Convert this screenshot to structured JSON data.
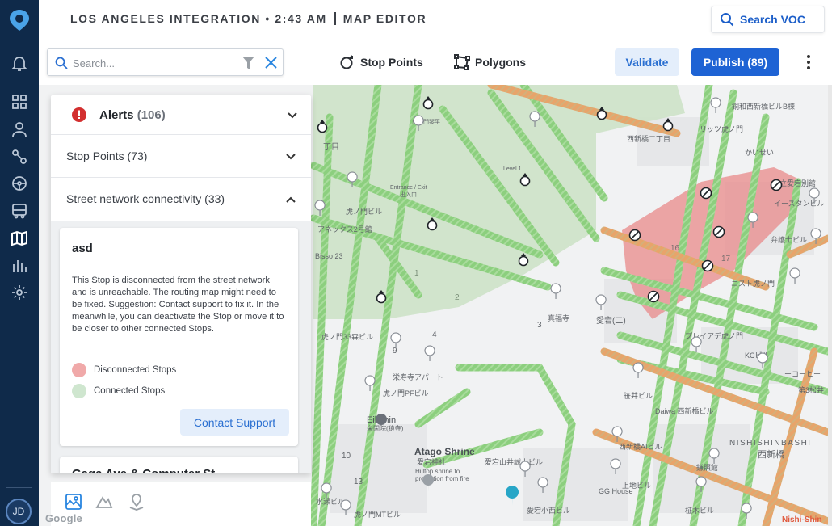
{
  "header": {
    "title": "LOS ANGELES INTEGRATION • 2:43 AM",
    "section": "MAP EDITOR",
    "search_voc_label": "Search VOC"
  },
  "toolbar": {
    "search_placeholder": "Search...",
    "stop_points_label": "Stop Points",
    "polygons_label": "Polygons",
    "validate_label": "Validate",
    "publish_label": "Publish (89)"
  },
  "user": {
    "initials": "JD"
  },
  "panel": {
    "alerts_label": "Alerts",
    "alerts_count": "(106)",
    "stop_points_row": "Stop Points (73)",
    "street_row": "Street network connectivity (33)",
    "card": {
      "title": "asd",
      "description": "This Stop is disconnected from the street network and is unreachable. The routing map might need to be fixed. Suggestion: Contact support to fix it. In the meanwhile, you can deactivate the Stop or move it to be closer to other connected Stops.",
      "legend_disconnected": "Disconnected Stops",
      "legend_connected": "Connected Stops",
      "contact_label": "Contact Support"
    },
    "next_card_title": "Gaga Ave & Computer St"
  },
  "map": {
    "google_label": "Google",
    "corner_label": "Nishi-Shin",
    "labels": [
      {
        "t": "Atago Shrine"
      },
      {
        "t": "愛宕神社"
      },
      {
        "t": "Hilltop shrine to"
      },
      {
        "t": "protection from fire"
      },
      {
        "t": "Eikanin"
      },
      {
        "t": "栄閑院(猿寺)"
      },
      {
        "t": "NISHISHINBASHI"
      },
      {
        "t": "西新橋"
      },
      {
        "t": "真福寺"
      },
      {
        "t": "愛宕(二)"
      },
      {
        "t": "プレイアデ虎ノ門"
      },
      {
        "t": "KCビル"
      },
      {
        "t": "笹井ビル"
      },
      {
        "t": "Daiwa 西新橋ビル"
      },
      {
        "t": "西新橋AIビル"
      },
      {
        "t": "GG House"
      },
      {
        "t": "上地ビル"
      },
      {
        "t": "鎌照館"
      },
      {
        "t": "柾木ビル"
      },
      {
        "t": "虎ノ門33森ビル"
      },
      {
        "t": "栄寿寺アパート"
      },
      {
        "t": "虎ノ門PFビル"
      },
      {
        "t": "水瀬ビル"
      },
      {
        "t": "愛宕山井誠士ビル"
      },
      {
        "t": "愛宕小西ビル"
      },
      {
        "t": "虎ノ門MTビル"
      },
      {
        "t": "リッツ虎ノ門"
      },
      {
        "t": "かいせい"
      },
      {
        "t": "銅和西新橋ビルB棟"
      },
      {
        "t": "日立愛宕別館"
      },
      {
        "t": "イースタンビル"
      },
      {
        "t": "弁護士ビル"
      },
      {
        "t": "ニスト虎ノ門"
      },
      {
        "t": "ーコーヒー"
      },
      {
        "t": "第3松井"
      },
      {
        "t": "Entrance / Exit"
      },
      {
        "t": "出入口"
      },
      {
        "t": "Level 1"
      },
      {
        "t": "アネックス2号館"
      },
      {
        "t": "Bisso 23"
      },
      {
        "t": "虎ノ門ビル"
      },
      {
        "t": "虎ノ門琴平"
      },
      {
        "t": "西新橋二丁目"
      },
      {
        "t": "丁目"
      },
      {
        "t": "16"
      },
      {
        "t": "17"
      },
      {
        "t": "1"
      },
      {
        "t": "2"
      },
      {
        "t": "3"
      },
      {
        "t": "4"
      },
      {
        "t": "9"
      },
      {
        "t": "10"
      },
      {
        "t": "13"
      }
    ]
  },
  "colors": {
    "rail": "#0f2a4a",
    "accent": "#1e63d4",
    "polygon_disconnected": "#e88a8a",
    "polygon_connected": "#b7d9b7"
  }
}
